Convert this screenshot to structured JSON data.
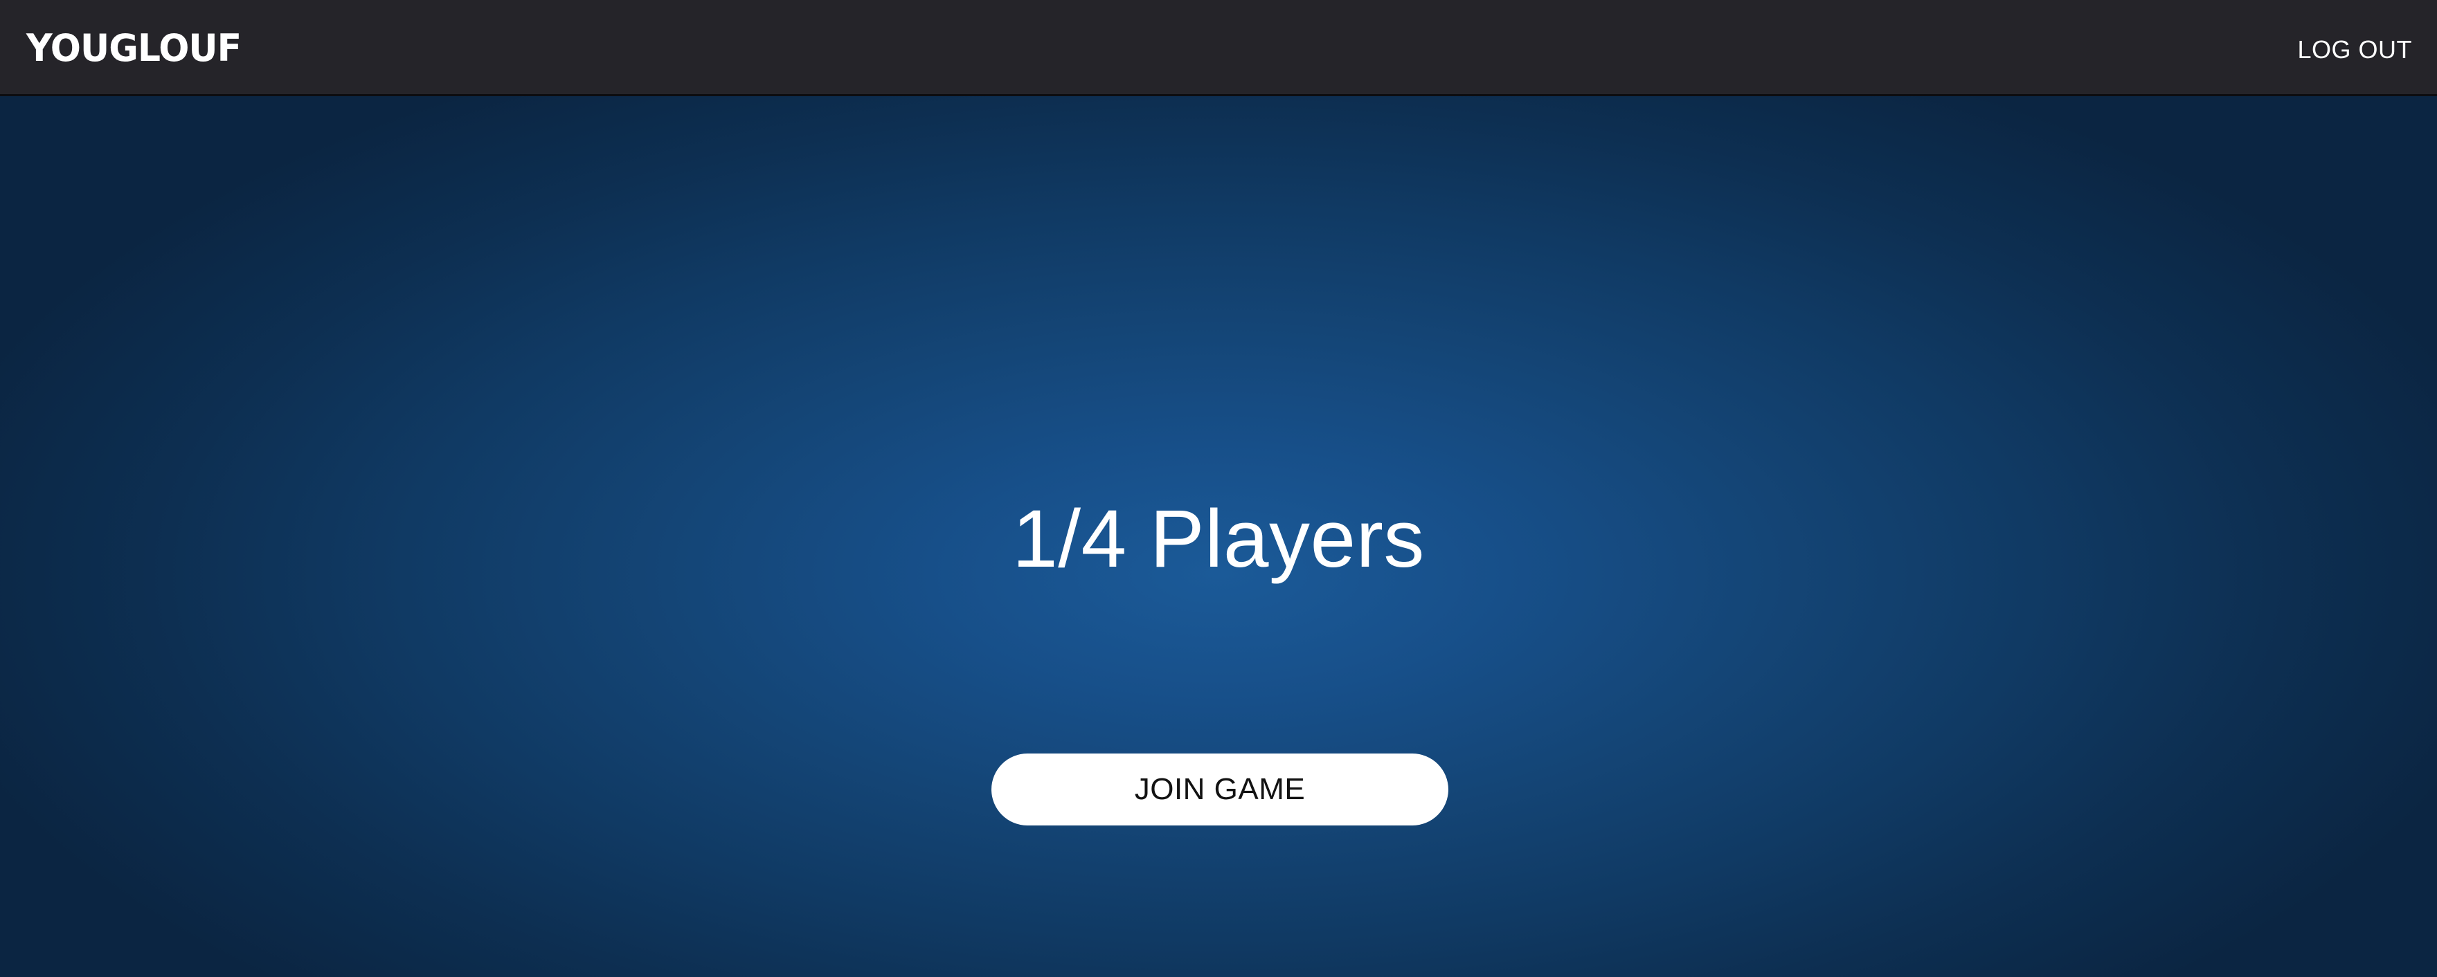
{
  "header": {
    "logo_text": "YOUGLOUF",
    "logout_label": "LOG OUT"
  },
  "lobby": {
    "players_status": "1/4 Players",
    "join_label": "JOIN GAME"
  },
  "colors": {
    "header_bg": "#252429",
    "background_center": "#1b5a98",
    "background_edge": "#0b2542",
    "button_bg": "#ffffff",
    "text_light": "#ffffff",
    "text_dark": "#121212"
  }
}
